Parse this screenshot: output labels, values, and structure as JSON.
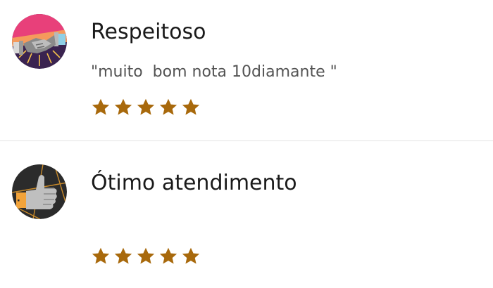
{
  "reviews": [
    {
      "badge_icon": "handshake-icon",
      "title": "Respeitoso",
      "comment": "\"muito  bom nota 10diamante \"",
      "rating": 5,
      "rating_max": 5
    },
    {
      "badge_icon": "thumbs-up-icon",
      "title": "Ótimo atendimento",
      "comment": "",
      "rating": 5,
      "rating_max": 5
    }
  ],
  "colors": {
    "star": "#a8690c",
    "badge1_top": "#e8407a",
    "badge1_bottom": "#3a2350",
    "badge2_bg": "#2b2b2b",
    "badge2_accent": "#f2a33a"
  }
}
